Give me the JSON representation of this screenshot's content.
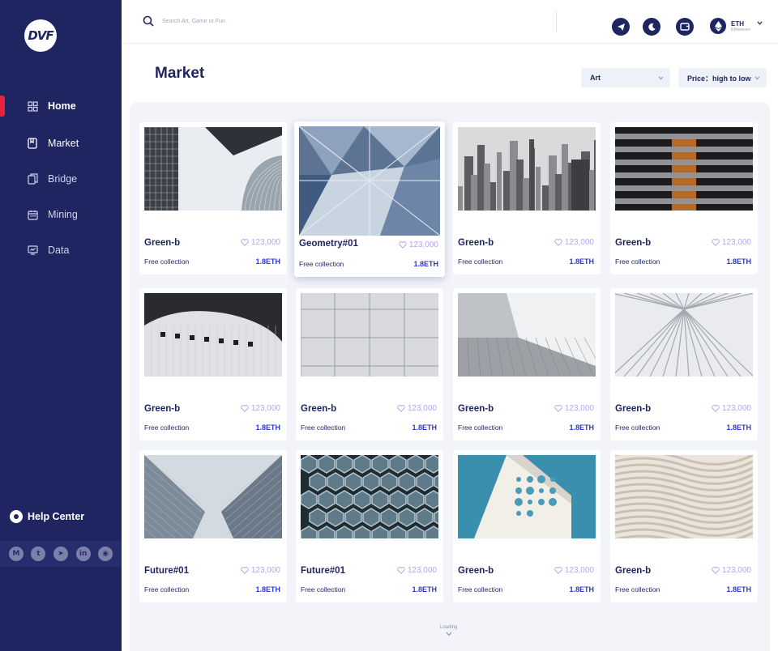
{
  "sidebar": {
    "logo_text": "DVF",
    "nav": [
      {
        "label": "Home",
        "icon": "grid-icon"
      },
      {
        "label": "Market",
        "icon": "bookmark-icon"
      },
      {
        "label": "Bridge",
        "icon": "copy-icon"
      },
      {
        "label": "Mining",
        "icon": "calendar-icon"
      },
      {
        "label": "Data",
        "icon": "chart-card-icon"
      }
    ],
    "help_label": "Help Center",
    "socials": [
      {
        "glyph": "M",
        "name": "medium-icon"
      },
      {
        "glyph": "t",
        "name": "twitter-icon"
      },
      {
        "glyph": "➤",
        "name": "telegram-icon"
      },
      {
        "glyph": "in",
        "name": "linkedin-icon"
      },
      {
        "glyph": "◉",
        "name": "github-icon"
      }
    ]
  },
  "topbar": {
    "search_placeholder": "Search Art, Game or Fun",
    "network_symbol": "ETH",
    "network_name": "Ethereum"
  },
  "page": {
    "title": "Market",
    "category_select": "Art",
    "sort_select": "Price：high to low",
    "loading": "Loading"
  },
  "cards": [
    {
      "name": "Green-b",
      "likes": "123,000",
      "sub": "Free collection",
      "price": "1.8ETH",
      "image": "glass-towers"
    },
    {
      "name": "Geometry#01",
      "likes": "123,000",
      "sub": "Free collection",
      "price": "1.8ETH",
      "image": "geometry-glass"
    },
    {
      "name": "Green-b",
      "likes": "123,000",
      "sub": "Free collection",
      "price": "1.8ETH",
      "image": "city-skyline"
    },
    {
      "name": "Green-b",
      "likes": "123,000",
      "sub": "Free collection",
      "price": "1.8ETH",
      "image": "curved-floors"
    },
    {
      "name": "Green-b",
      "likes": "123,000",
      "sub": "Free collection",
      "price": "1.8ETH",
      "image": "white-curve-building"
    },
    {
      "name": "Green-b",
      "likes": "123,000",
      "sub": "Free collection",
      "price": "1.8ETH",
      "image": "tiled-wall"
    },
    {
      "name": "Green-b",
      "likes": "123,000",
      "sub": "Free collection",
      "price": "1.8ETH",
      "image": "overhang"
    },
    {
      "name": "Green-b",
      "likes": "123,000",
      "sub": "Free collection",
      "price": "1.8ETH",
      "image": "ribbed-ceiling"
    },
    {
      "name": "Future#01",
      "likes": "123,000",
      "sub": "Free collection",
      "price": "1.8ETH",
      "image": "towers-upward"
    },
    {
      "name": "Future#01",
      "likes": "123,000",
      "sub": "Free collection",
      "price": "1.8ETH",
      "image": "hex-facade"
    },
    {
      "name": "Green-b",
      "likes": "123,000",
      "sub": "Free collection",
      "price": "1.8ETH",
      "image": "holes-building"
    },
    {
      "name": "Green-b",
      "likes": "123,000",
      "sub": "Free collection",
      "price": "1.8ETH",
      "image": "wave-facade"
    }
  ],
  "colors": {
    "sidebar": "#1f2560",
    "accent_red": "#e8223e",
    "price_blue": "#2b36d6",
    "likes_purple": "#b5a6ee"
  }
}
